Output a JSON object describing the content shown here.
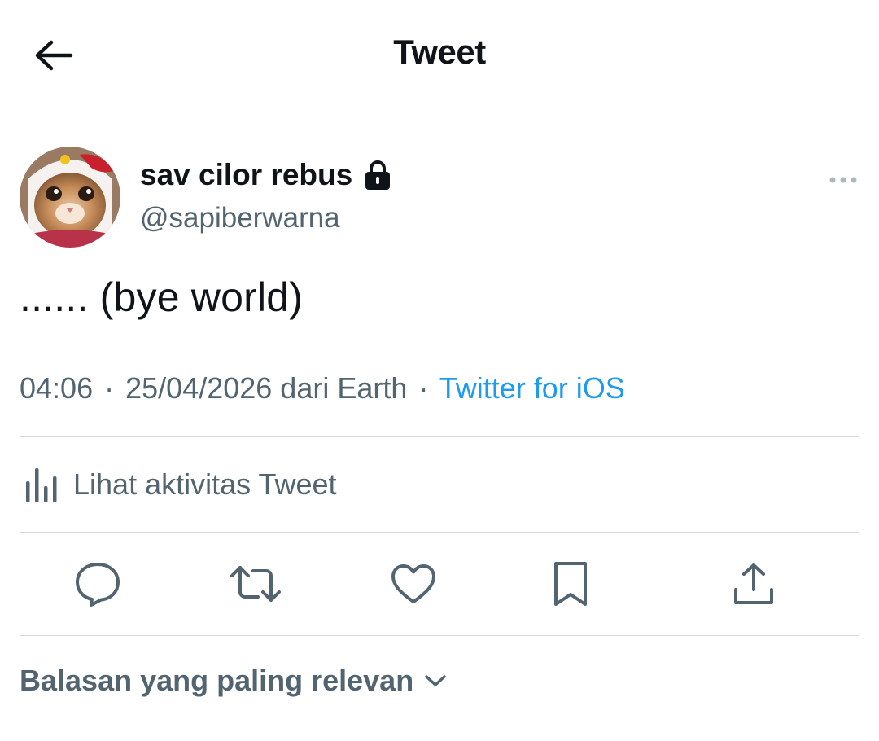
{
  "header": {
    "title": "Tweet",
    "back_icon": "arrow-left-icon"
  },
  "author": {
    "display_name": "sav cilor rebus",
    "handle": "@sapiberwarna",
    "protected_icon": "lock-icon",
    "avatar": "cat-avatar"
  },
  "tweet": {
    "text": "...... (bye world)",
    "time": "04:06",
    "date_location": "25/04/2026 dari Earth",
    "separator": "·",
    "source": "Twitter for iOS"
  },
  "analytics": {
    "label": "Lihat aktivitas Tweet",
    "icon": "bar-chart-icon"
  },
  "actions": [
    {
      "name": "reply",
      "icon": "reply-icon"
    },
    {
      "name": "retweet",
      "icon": "retweet-icon"
    },
    {
      "name": "like",
      "icon": "heart-icon"
    },
    {
      "name": "bookmark",
      "icon": "bookmark-icon"
    },
    {
      "name": "share",
      "icon": "share-icon"
    }
  ],
  "replies": {
    "sort_label": "Balasan yang paling relevan",
    "chevron_icon": "chevron-down-icon"
  },
  "colors": {
    "text_primary": "#0f1419",
    "text_secondary": "#536471",
    "link": "#1d9bf0",
    "divider": "#cfd9de"
  }
}
